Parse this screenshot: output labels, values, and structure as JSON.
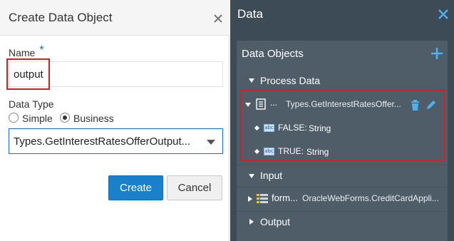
{
  "dialog": {
    "title": "Create Data Object",
    "name_label": "Name",
    "required_mark": "*",
    "name_value": "output",
    "data_type_label": "Data Type",
    "radio_simple": "Simple",
    "radio_business": "Business",
    "selected_data_type": "Business",
    "select_value": "Types.GetInterestRatesOfferOutput...",
    "create_label": "Create",
    "cancel_label": "Cancel",
    "close_icon": "close-icon"
  },
  "panel": {
    "title": "Data",
    "close_icon": "close-icon",
    "section_title": "Data Objects",
    "add_icon": "plus-icon",
    "tree": {
      "process_data_label": "Process Data",
      "object_ellipsis": "...",
      "object_type": "Types.GetInterestRatesOffer...",
      "false_name": "FALSE:",
      "false_type": "String",
      "true_name": "TRUE:",
      "true_type": "String",
      "input_label": "Input",
      "form_name": "form...",
      "form_type": "OracleWebForms.CreditCardAppli...",
      "output_label": "Output",
      "abc_badge": "abc"
    }
  },
  "colors": {
    "accent": "#1a80c9",
    "highlight": "#d0202a",
    "panel_bg": "#3d4b57",
    "tree_bg": "#4f5d69",
    "icon_blue": "#4fb0f0"
  }
}
